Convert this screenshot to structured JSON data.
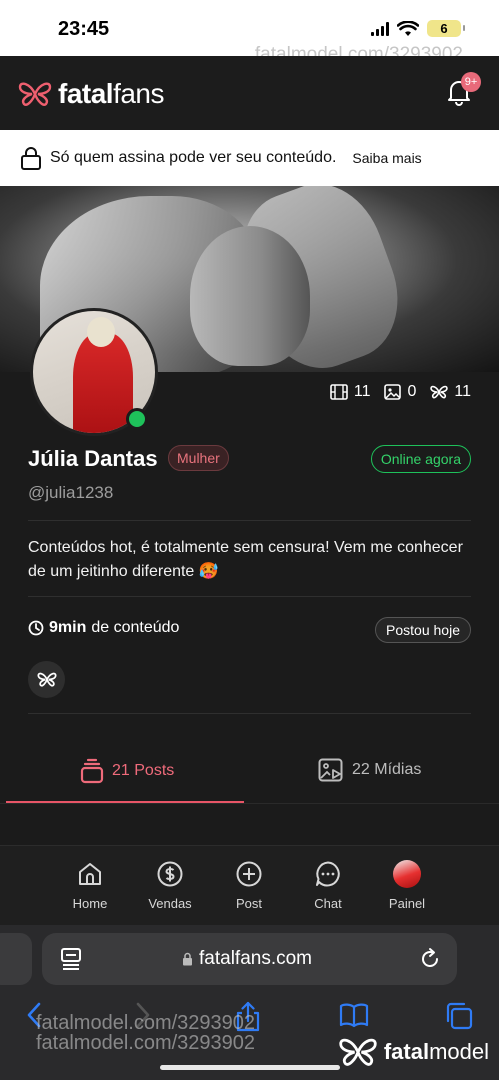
{
  "status_bar": {
    "time": "23:45",
    "battery": "6"
  },
  "watermark": {
    "text": "fatalmodel.com/3293902",
    "logo_text_bold": "fatal",
    "logo_text_thin": "model"
  },
  "header": {
    "logo_bold": "fatal",
    "logo_thin": "fans",
    "notifications_badge": "9+"
  },
  "notice": {
    "message": "Só quem assina pode ver seu conteúdo.",
    "link": "Saiba mais"
  },
  "profile": {
    "stats": {
      "videos": "11",
      "photos": "0",
      "butterflies": "11"
    },
    "name": "Júlia Dantas",
    "gender": "Mulher",
    "status": "Online agora",
    "handle": "@julia1238",
    "bio": "Conteúdos hot, é totalmente sem censura! Vem me conhecer de um jeitinho diferente 🥵",
    "duration_value": "9min",
    "duration_suffix": "de conteúdo",
    "posted_badge": "Postou hoje"
  },
  "tabs": [
    {
      "label": "21 Posts",
      "active": true
    },
    {
      "label": "22 Mídias",
      "active": false
    }
  ],
  "bottom_nav": [
    {
      "label": "Home",
      "icon": "home-icon"
    },
    {
      "label": "Vendas",
      "icon": "dollar-icon"
    },
    {
      "label": "Post",
      "icon": "plus-circle-icon"
    },
    {
      "label": "Chat",
      "icon": "chat-icon"
    },
    {
      "label": "Painel",
      "icon": "avatar"
    }
  ],
  "browser": {
    "url": "fatalfans.com"
  },
  "colors": {
    "accent": "#e85567",
    "online": "#1ec15a",
    "background": "#1b1b1b"
  }
}
